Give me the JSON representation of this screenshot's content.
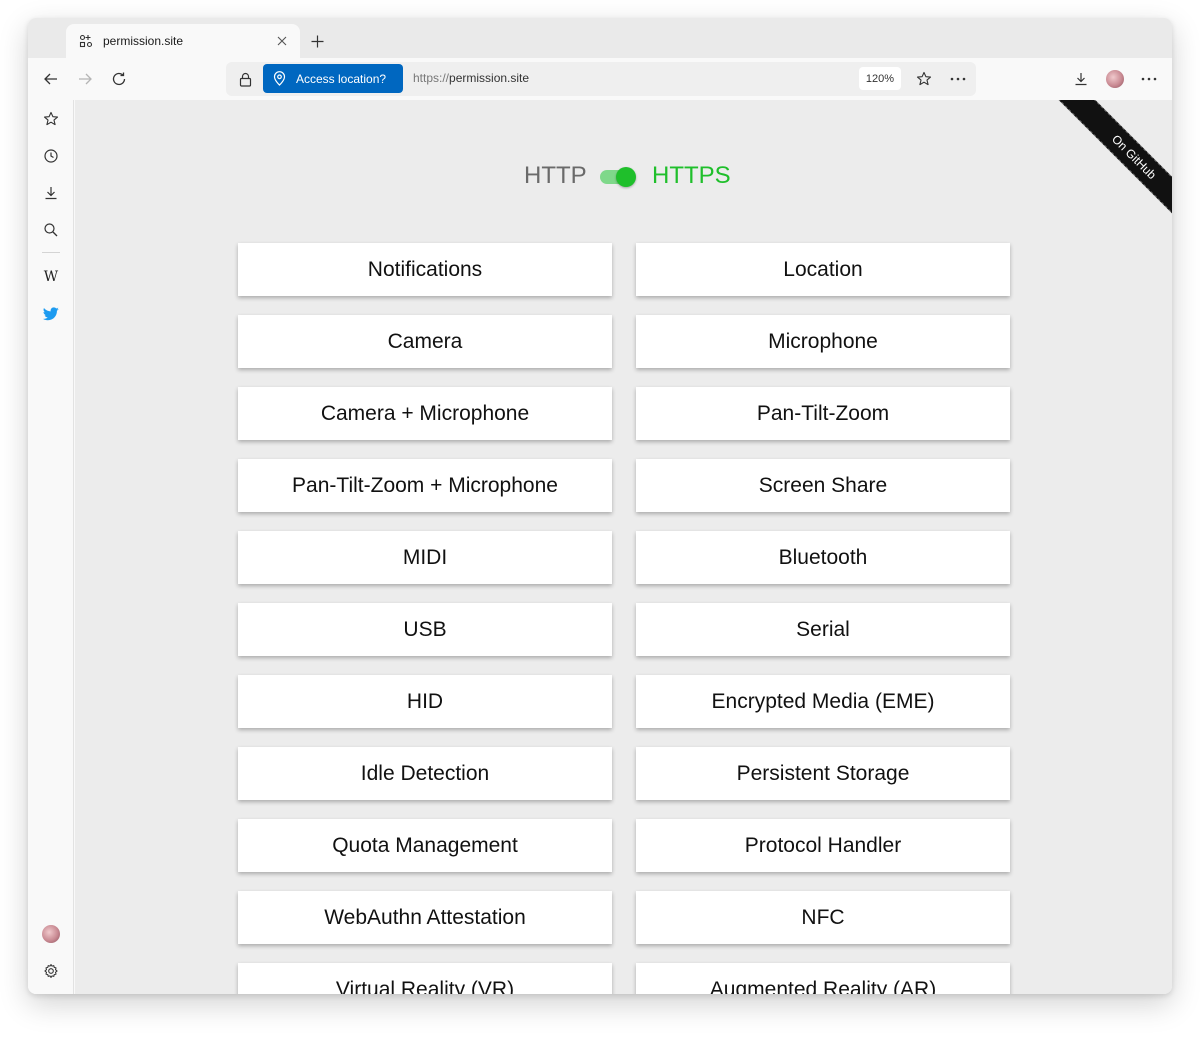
{
  "tab": {
    "title": "permission.site"
  },
  "address": {
    "permission_prompt": "Access location?",
    "url_scheme": "https://",
    "url_host": "permission.site",
    "zoom": "120%"
  },
  "protocol": {
    "http_label": "HTTP",
    "https_label": "HTTPS",
    "selected": "HTTPS"
  },
  "ribbon": {
    "label": "On GitHub"
  },
  "buttons": [
    "Notifications",
    "Location",
    "Camera",
    "Microphone",
    "Camera + Microphone",
    "Pan-Tilt-Zoom",
    "Pan-Tilt-Zoom + Microphone",
    "Screen Share",
    "MIDI",
    "Bluetooth",
    "USB",
    "Serial",
    "HID",
    "Encrypted Media (EME)",
    "Idle Detection",
    "Persistent Storage",
    "Quota Management",
    "Protocol Handler",
    "WebAuthn Attestation",
    "NFC",
    "Virtual Reality (VR)",
    "Augmented Reality (AR)"
  ],
  "sidebar": {
    "items": [
      "favorites-icon",
      "history-icon",
      "downloads-icon",
      "search-icon",
      "wikipedia-icon",
      "twitter-icon"
    ]
  },
  "colors": {
    "accent": "#0067c0",
    "https_green": "#1fbf2b",
    "content_bg": "#ececec"
  }
}
